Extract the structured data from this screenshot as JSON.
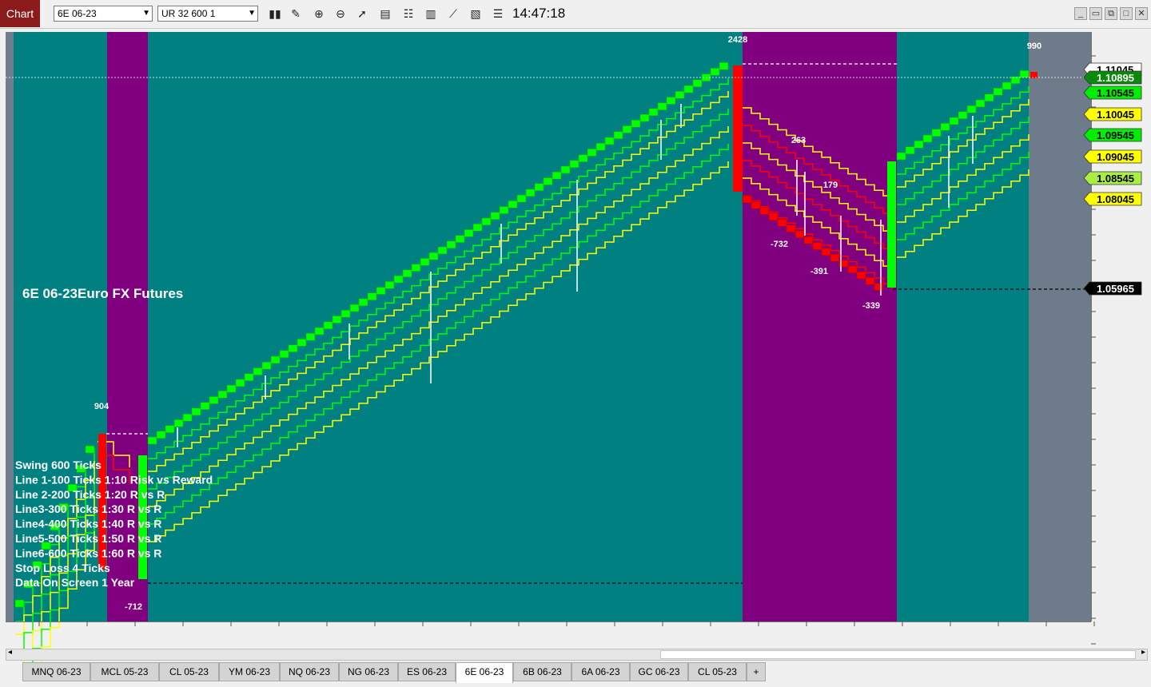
{
  "toolbar": {
    "chart_label": "Chart",
    "instrument": "6E 06-23",
    "bar_type": "UR 32 600 1",
    "clock": "14:47:18",
    "tools": [
      "bars-icon",
      "pencil-icon",
      "zoom-in-icon",
      "zoom-out-icon",
      "cursor-icon",
      "data-box-icon",
      "properties-icon",
      "bar-chart-icon",
      "indicator-icon",
      "strategy-icon",
      "list-icon"
    ]
  },
  "chart": {
    "title": "6E 06-23Euro FX Futures",
    "legend_lines": [
      "Swing 600 Ticks",
      "Line 1-100  Ticks 1:10 Risk vs  Reward",
      "Line 2-200  Ticks 1:20 R vs R",
      "Line3-300  Ticks  1:30 R vs R",
      "Line4-400  Ticks  1:40 R vs R",
      "Line5-500  Ticks  1:50 R vs R",
      "Line6-600  Ticks  1:60 R vs R",
      "Stop Loss 4 Ticks",
      "Data On Screen 1 Year"
    ],
    "annotations": [
      "904",
      "-712",
      "2428",
      "263",
      "179",
      "-732",
      "-391",
      "-339",
      "990"
    ],
    "price_labels": [
      {
        "text": "1.11045",
        "color": "#ffffff"
      },
      {
        "text": "1.10895",
        "color": "#0a8a0a"
      },
      {
        "text": "1.10545",
        "color": "#00ee00"
      },
      {
        "text": "1.10045",
        "color": "#ffff00"
      },
      {
        "text": "1.09545",
        "color": "#00ee00"
      },
      {
        "text": "1.09045",
        "color": "#ffff00"
      },
      {
        "text": "1.08545",
        "color": "#aaee44"
      },
      {
        "text": "1.08045",
        "color": "#ffff00"
      },
      {
        "text": "1.05965",
        "color": "#000000"
      }
    ],
    "colors": {
      "teal": "#008080",
      "purple": "#800080",
      "green": "#00ff00",
      "red": "#ff0000",
      "yellow": "#ffff00",
      "grey": "#707d8c"
    }
  },
  "tabs": [
    "MNQ 06-23",
    "MCL 05-23",
    "CL 05-23",
    "YM 06-23",
    "NQ 06-23",
    "NG 06-23",
    "ES 06-23",
    "6E 06-23",
    "6B 06-23",
    "6A 06-23",
    "GC 06-23",
    "CL 05-23",
    "+"
  ],
  "active_tab": "6E 06-23"
}
